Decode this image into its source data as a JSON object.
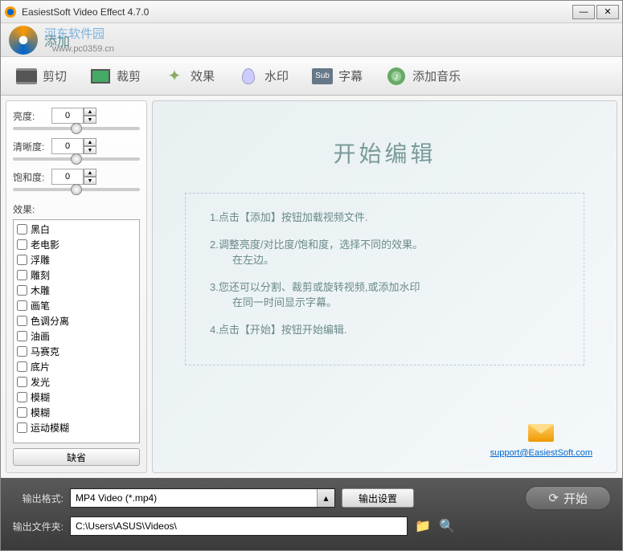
{
  "title": "EasiestSoft Video Effect 4.7.0",
  "header": {
    "add_label": "添加",
    "watermark": "www.pc0359.cn",
    "brand_watermark": "河东软件园"
  },
  "toolbar": {
    "cut": "剪切",
    "crop": "裁剪",
    "effect": "效果",
    "watermark": "水印",
    "subtitle": "字幕",
    "music": "添加音乐",
    "sub_badge": "Sub"
  },
  "adjust": {
    "brightness_label": "亮度:",
    "brightness_value": "0",
    "sharpness_label": "清晰度:",
    "sharpness_value": "0",
    "saturation_label": "饱和度:",
    "saturation_value": "0"
  },
  "effects": {
    "label": "效果:",
    "items": [
      "黑白",
      "老电影",
      "浮雕",
      "雕刻",
      "木雕",
      "画笔",
      "色调分离",
      "油画",
      "马赛克",
      "底片",
      "发光",
      "模糊",
      "模糊",
      "运动模糊"
    ],
    "default_btn": "缺省"
  },
  "preview": {
    "title": "开始编辑",
    "step1": "1.点击【添加】按钮加载视频文件.",
    "step2": "2.调整亮度/对比度/饱和度，选择不同的效果。",
    "step2b": "在左边。",
    "step3": "3.您还可以分割、裁剪或旋转视频,或添加水印",
    "step3b": "在同一时间显示字幕。",
    "step4": "4.点击【开始】按钮开始编辑.",
    "support_link": "support@EasiestSoft.com"
  },
  "bottom": {
    "format_label": "输出格式:",
    "format_value": "MP4 Video (*.mp4)",
    "settings_btn": "输出设置",
    "start_btn": "开始",
    "folder_label": "输出文件夹:",
    "folder_value": "C:\\Users\\ASUS\\Videos\\"
  }
}
